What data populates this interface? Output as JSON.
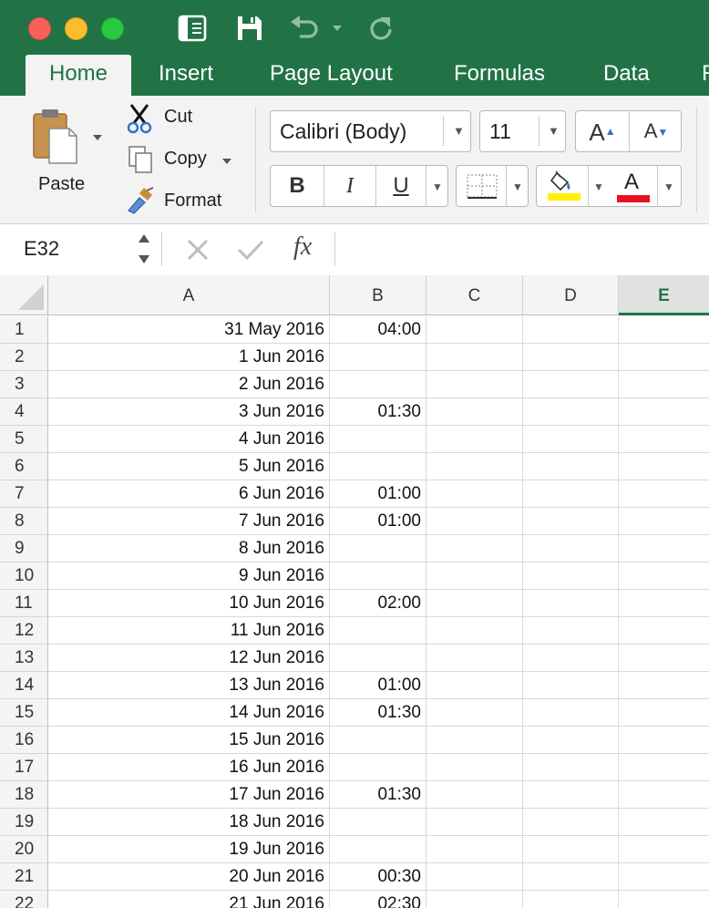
{
  "ribbon_tabs": [
    "Home",
    "Insert",
    "Page Layout",
    "Formulas",
    "Data",
    "R"
  ],
  "clipboard": {
    "paste": "Paste",
    "cut": "Cut",
    "copy": "Copy",
    "format": "Format"
  },
  "font": {
    "name": "Calibri (Body)",
    "size": "11",
    "grow_label": "A",
    "shrink_label": "A",
    "bold": "B",
    "italic": "I",
    "underline": "U",
    "font_color_letter": "A",
    "fill_color": "#fff200",
    "font_color": "#e81123"
  },
  "formula_bar": {
    "name_box": "E32",
    "fx": "fx",
    "content": ""
  },
  "columns": [
    "A",
    "B",
    "C",
    "D",
    "E"
  ],
  "selected_column": "E",
  "rows": [
    {
      "n": "1",
      "a": "31 May 2016",
      "b": "04:00"
    },
    {
      "n": "2",
      "a": "1 Jun 2016",
      "b": ""
    },
    {
      "n": "3",
      "a": "2 Jun 2016",
      "b": ""
    },
    {
      "n": "4",
      "a": "3 Jun 2016",
      "b": "01:30"
    },
    {
      "n": "5",
      "a": "4 Jun 2016",
      "b": ""
    },
    {
      "n": "6",
      "a": "5 Jun 2016",
      "b": ""
    },
    {
      "n": "7",
      "a": "6 Jun 2016",
      "b": "01:00"
    },
    {
      "n": "8",
      "a": "7 Jun 2016",
      "b": "01:00"
    },
    {
      "n": "9",
      "a": "8 Jun 2016",
      "b": ""
    },
    {
      "n": "10",
      "a": "9 Jun 2016",
      "b": ""
    },
    {
      "n": "11",
      "a": "10 Jun 2016",
      "b": "02:00"
    },
    {
      "n": "12",
      "a": "11 Jun 2016",
      "b": ""
    },
    {
      "n": "13",
      "a": "12 Jun 2016",
      "b": ""
    },
    {
      "n": "14",
      "a": "13 Jun 2016",
      "b": "01:00"
    },
    {
      "n": "15",
      "a": "14 Jun 2016",
      "b": "01:30"
    },
    {
      "n": "16",
      "a": "15 Jun 2016",
      "b": ""
    },
    {
      "n": "17",
      "a": "16 Jun 2016",
      "b": ""
    },
    {
      "n": "18",
      "a": "17 Jun 2016",
      "b": "01:30"
    },
    {
      "n": "19",
      "a": "18 Jun 2016",
      "b": ""
    },
    {
      "n": "20",
      "a": "19 Jun 2016",
      "b": ""
    },
    {
      "n": "21",
      "a": "20 Jun 2016",
      "b": "00:30"
    },
    {
      "n": "22",
      "a": "21 Jun 2016",
      "b": "02:30"
    }
  ]
}
